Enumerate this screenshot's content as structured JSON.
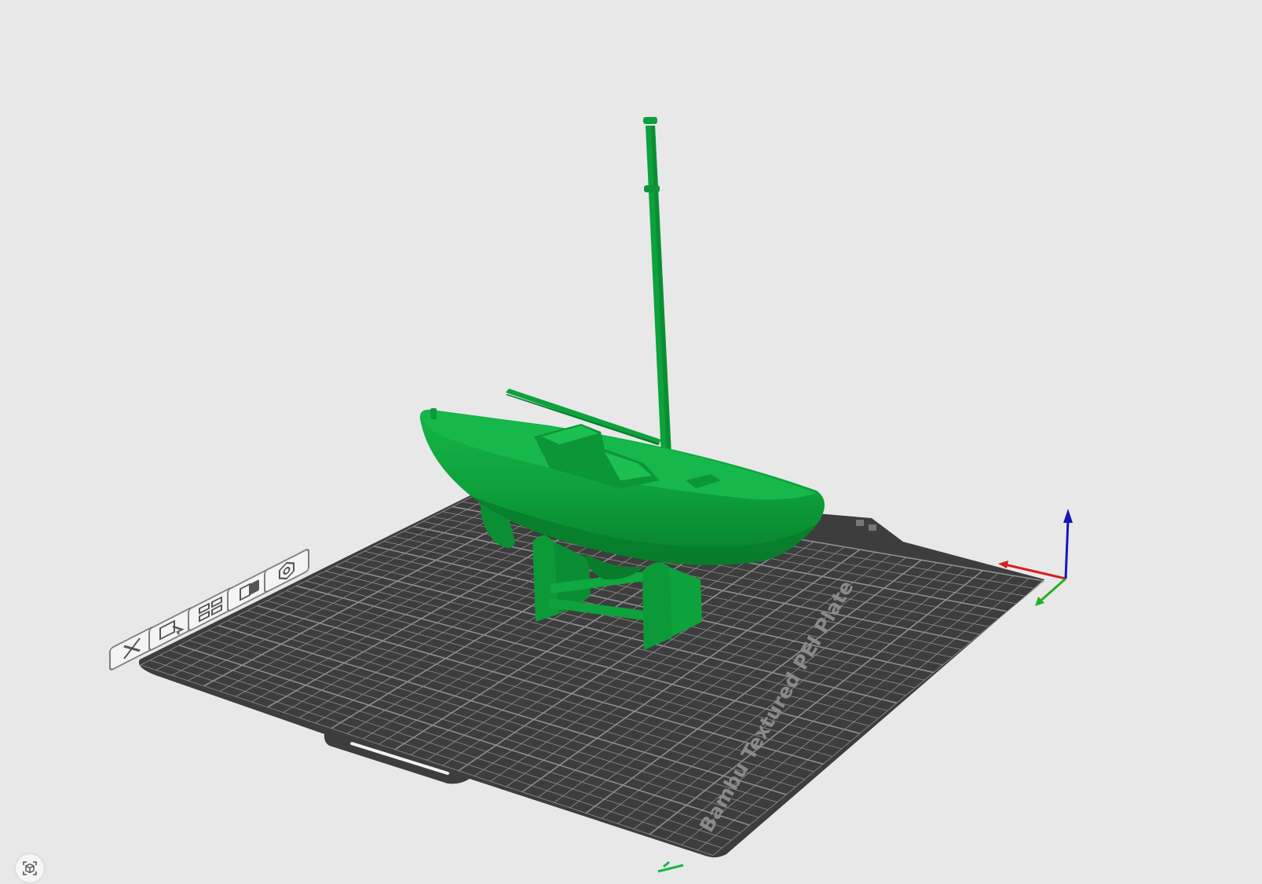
{
  "viewport": {
    "background": "#e8e8e8"
  },
  "plate": {
    "label": "Bambu Textured PEI Plate",
    "plate_color": "#3d3d3d",
    "grid_color": "#8f8f8f"
  },
  "model": {
    "color": "#0da23c",
    "color_dark": "#087f2c",
    "color_light": "#16b548"
  },
  "plate_toolbar": {
    "items": [
      {
        "name": "remove-plate-icon"
      },
      {
        "name": "pick-object-icon"
      },
      {
        "name": "arrange-icon"
      },
      {
        "name": "lock-plate-icon"
      },
      {
        "name": "plate-settings-icon"
      }
    ]
  },
  "axes": {
    "x_color": "#d42020",
    "y_color": "#22b022",
    "z_color": "#1616b8"
  },
  "view_cube": {
    "icon": "view-cube-icon"
  }
}
